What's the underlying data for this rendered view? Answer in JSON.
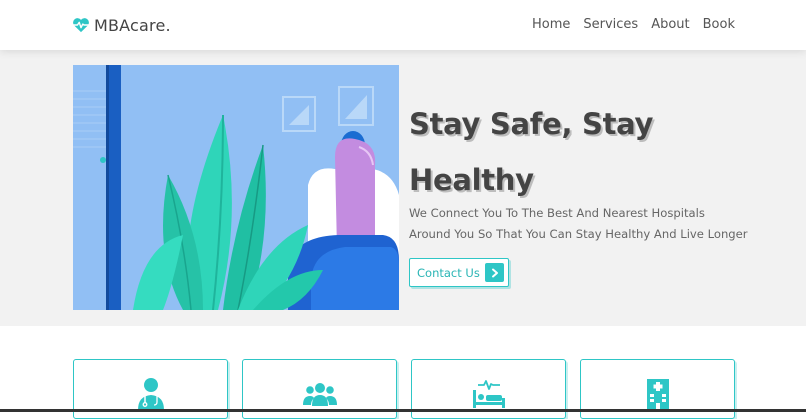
{
  "header": {
    "logo_text": "MBAcare.",
    "nav": [
      "Home",
      "Services",
      "About",
      "Book"
    ]
  },
  "hero": {
    "title": "Stay Safe, Stay Healthy",
    "description": "We Connect You To The Best And Nearest Hospitals Around You So That You Can Stay Healthy And Live Longer",
    "cta_label": "Contact Us"
  },
  "cards": [
    {
      "icon": "doctor-icon"
    },
    {
      "icon": "users-icon"
    },
    {
      "icon": "hospital-bed-icon"
    },
    {
      "icon": "hospital-building-icon"
    }
  ],
  "colors": {
    "accent": "#2ec6c6",
    "illustration_bg": "#91bff4",
    "hero_bg": "#f2f2f2",
    "title": "#444444"
  }
}
